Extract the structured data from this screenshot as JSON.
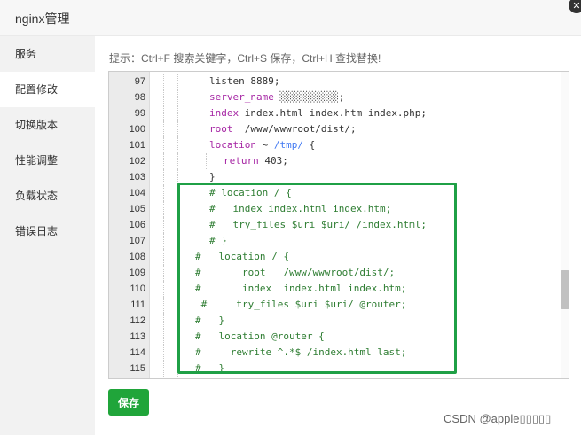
{
  "window": {
    "title": "nginx管理",
    "close_icon": "✕"
  },
  "sidebar": {
    "items": [
      {
        "label": "服务",
        "active": false
      },
      {
        "label": "配置修改",
        "active": true
      },
      {
        "label": "切换版本",
        "active": false
      },
      {
        "label": "性能调整",
        "active": false
      },
      {
        "label": "负载状态",
        "active": false
      },
      {
        "label": "错误日志",
        "active": false
      }
    ]
  },
  "hint": "提示：Ctrl+F 搜索关键字，Ctrl+S 保存，Ctrl+H 查找替换!",
  "editor": {
    "lines": [
      {
        "n": "97",
        "indent": 3,
        "tokens": [
          [
            "pl",
            "listen 8889;"
          ]
        ]
      },
      {
        "n": "98",
        "indent": 3,
        "tokens": [
          [
            "kw",
            "server_name "
          ],
          [
            "pl",
            "░░░░░░░░░░;"
          ]
        ]
      },
      {
        "n": "99",
        "indent": 3,
        "tokens": [
          [
            "kw",
            "index "
          ],
          [
            "pl",
            "index.html index.htm index.php;"
          ]
        ]
      },
      {
        "n": "100",
        "indent": 3,
        "tokens": [
          [
            "kw",
            "root  "
          ],
          [
            "pl",
            "/www/wwwroot/dist/;"
          ]
        ]
      },
      {
        "n": "101",
        "indent": 3,
        "tokens": [
          [
            "kw",
            "location "
          ],
          [
            "pl",
            "~ "
          ],
          [
            "rx",
            "/tmp/"
          ],
          [
            "pl",
            " {"
          ]
        ]
      },
      {
        "n": "102",
        "indent": 4,
        "tokens": [
          [
            "kw",
            "return "
          ],
          [
            "pl",
            "403;"
          ]
        ]
      },
      {
        "n": "103",
        "indent": 3,
        "tokens": [
          [
            "pl",
            "}"
          ]
        ]
      },
      {
        "n": "104",
        "indent": 3,
        "tokens": [
          [
            "cm",
            "# location / {"
          ]
        ]
      },
      {
        "n": "105",
        "indent": 3,
        "tokens": [
          [
            "cm",
            "#   index index.html index.htm;"
          ]
        ]
      },
      {
        "n": "106",
        "indent": 3,
        "tokens": [
          [
            "cm",
            "#   try_files $uri $uri/ /index.html;"
          ]
        ]
      },
      {
        "n": "107",
        "indent": 3,
        "tokens": [
          [
            "cm",
            "# }"
          ]
        ]
      },
      {
        "n": "108",
        "indent": 2,
        "tokens": [
          [
            "cm",
            "#   location / {"
          ]
        ]
      },
      {
        "n": "109",
        "indent": 2,
        "tokens": [
          [
            "cm",
            "#       root   /www/wwwroot/dist/;"
          ]
        ]
      },
      {
        "n": "110",
        "indent": 2,
        "tokens": [
          [
            "cm",
            "#       index  index.html index.htm;"
          ]
        ]
      },
      {
        "n": "111",
        "indent": 2,
        "tokens": [
          [
            "cm",
            " #     try_files $uri $uri/ @router;"
          ]
        ]
      },
      {
        "n": "112",
        "indent": 2,
        "tokens": [
          [
            "cm",
            "#   }"
          ]
        ]
      },
      {
        "n": "113",
        "indent": 2,
        "tokens": [
          [
            "cm",
            "#   location @router {"
          ]
        ]
      },
      {
        "n": "114",
        "indent": 2,
        "tokens": [
          [
            "cm",
            "#     rewrite ^.*$ /index.html last;"
          ]
        ]
      },
      {
        "n": "115",
        "indent": 2,
        "tokens": [
          [
            "cm",
            "#   }"
          ]
        ]
      }
    ]
  },
  "save_label": "保存",
  "watermark": "CSDN @apple▯▯▯▯▯",
  "colors": {
    "accent": "#20a53a",
    "highlight": "#1fa046",
    "keyword": "#a626a4",
    "comment": "#2e7d32"
  }
}
